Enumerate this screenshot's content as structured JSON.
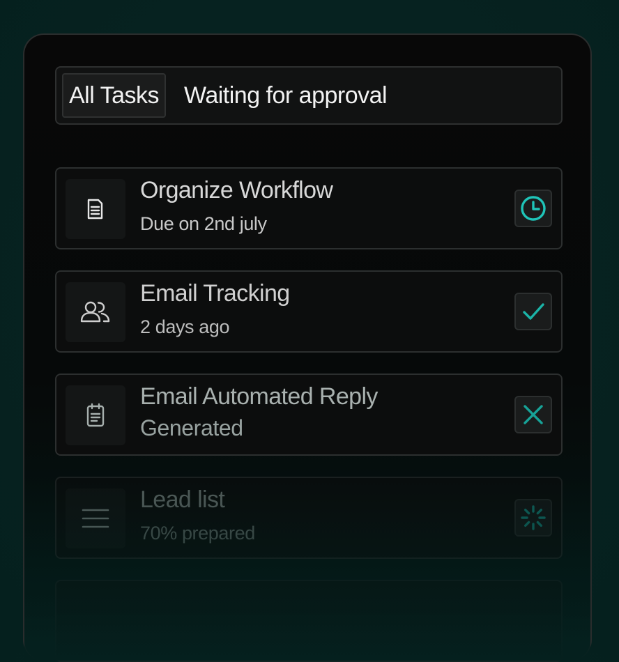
{
  "tabs": {
    "all": "All Tasks",
    "waiting": "Waiting for approval"
  },
  "tasks": [
    {
      "title": "Organize Workflow",
      "subtitle": "Due on 2nd july",
      "icon": "document-icon",
      "status": "clock-icon"
    },
    {
      "title": "Email Tracking",
      "subtitle": "2 days ago",
      "icon": "users-icon",
      "status": "check-icon"
    },
    {
      "title": "Email Automated Reply",
      "subtitle": "Generated",
      "icon": "clipboard-icon",
      "status": "close-icon"
    },
    {
      "title": "Lead list",
      "subtitle": "70% prepared",
      "icon": "menu-lines-icon",
      "status": "loading-icon"
    }
  ],
  "colors": {
    "accent": "#1fc4b8",
    "background": "#05201e",
    "panel": "#080808"
  }
}
